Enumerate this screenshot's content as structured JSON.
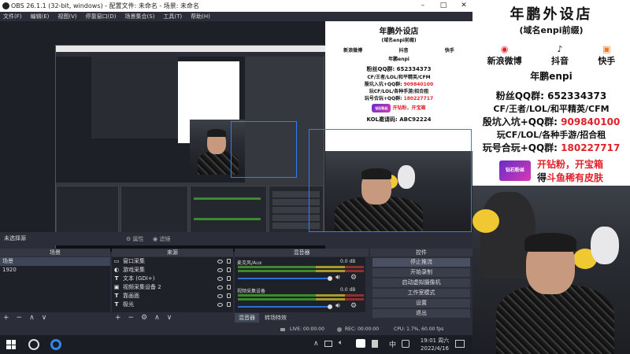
{
  "obs": {
    "title": "OBS 26.1.1 (32-bit, windows) - 配置文件: 未命名 - 场景: 未命名",
    "menu": [
      "文件(F)",
      "编辑(E)",
      "视图(V)",
      "停靠窗口(D)",
      "场景集合(S)",
      "工具(T)",
      "帮助(H)"
    ],
    "status_label": "未选择源",
    "properties_label": "属性",
    "filters_label": "滤镜"
  },
  "docks": {
    "scenes": {
      "title": "场景",
      "items": [
        "场景",
        "1920"
      ]
    },
    "sources": {
      "title": "来源",
      "items": [
        {
          "icon": "window-capture-icon",
          "label": "窗口采集"
        },
        {
          "icon": "game-capture-icon",
          "label": "游戏采集"
        },
        {
          "icon": "text-icon",
          "label": "文本 (GDI+)"
        },
        {
          "icon": "video-capture-icon",
          "label": "视频采集设备 2"
        },
        {
          "icon": "text-icon",
          "label": "靠画面"
        },
        {
          "icon": "text-icon",
          "label": "极光"
        }
      ]
    },
    "mixer": {
      "title": "混音器",
      "channels": [
        {
          "name": "麦克风/Aux",
          "level": "0.0 dB"
        },
        {
          "name": "视频采集设备",
          "level": "0.0 dB"
        }
      ],
      "tabs": [
        "混音器",
        "转场特效"
      ]
    },
    "controls": {
      "title": "控件",
      "buttons": [
        "停止推流",
        "开始录制",
        "启动虚拟摄像机",
        "工作室模式",
        "设置",
        "退出"
      ]
    }
  },
  "bottom_status": {
    "live": "LIVE: 00:00:00",
    "rec": "REC: 00:00:00",
    "cpu": "CPU: 1.7%, 60.00 fps"
  },
  "taskbar": {
    "time": "19:01 周六",
    "date": "2022/4/16",
    "lang": "中"
  },
  "overlay": {
    "shop_title": "年鹏外设店",
    "shop_subtitle": "(域名enpi前缀)",
    "socials": [
      {
        "icon": "weibo-icon",
        "label": "新浪微博"
      },
      {
        "icon": "douyin-icon",
        "label": "抖音"
      },
      {
        "icon": "kuaishou-icon",
        "label": "快手"
      }
    ],
    "handle": "年鹏enpi",
    "fan_group_label": "粉丝QQ群: ",
    "fan_group_number": "652334373",
    "games_line": "CF/王者/LOL/和平精英/CFM",
    "group1_label": "殷坑入坑+QQ群: ",
    "group1_number": "909840100",
    "games_line2": "玩CF/LOL/各种手游/招合租",
    "group2_label": "玩号合玩+QQ群: ",
    "group2_number": "180227717",
    "promo_line1_a": "开钻粉，",
    "promo_line1_b": "开宝箱",
    "promo_line2_a": "得",
    "promo_line2_b": "斗鱼稀有皮肤",
    "badge_text": "钻石粉丝",
    "kol_label": "KOL邀请码: ",
    "kol_code": "ABC92224"
  },
  "colors": {
    "obs_bg": "#2b2e38",
    "accent_red": "#e2202a",
    "selection": "#3d4556",
    "outline_blue": "#2d7ff5"
  }
}
